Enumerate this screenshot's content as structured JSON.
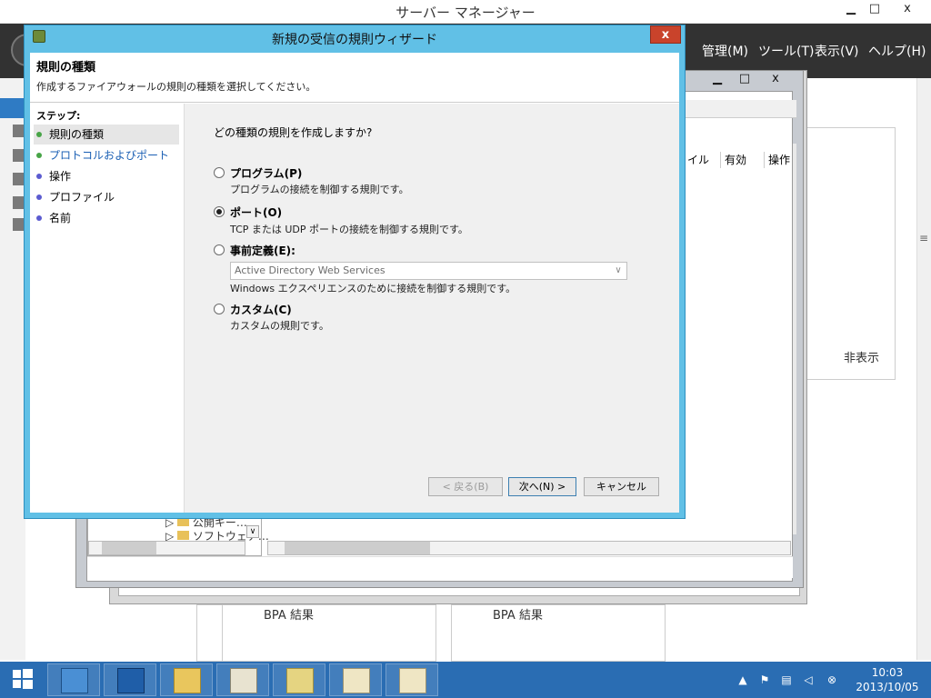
{
  "server_manager": {
    "title": "サーバー マネージャー",
    "menu": [
      "管理(M)",
      "ツール(T)",
      "表示(V)",
      "ヘルプ(H)"
    ],
    "hidden_link": "非表示",
    "bpa_label": "BPA 結果"
  },
  "background_window": {
    "columns": [
      "イル",
      "有効",
      "操作"
    ],
    "tree_items": [
      "公開キー…",
      "ソフトウェア…"
    ]
  },
  "wizard": {
    "title": "新規の受信の規則ウィザード",
    "heading": "規則の種類",
    "subtitle": "作成するファイアウォールの規則の種類を選択してください。",
    "steps_label": "ステップ:",
    "steps": [
      {
        "label": "規則の種類",
        "state": "done"
      },
      {
        "label": "プロトコルおよびポート",
        "state": "done"
      },
      {
        "label": "操作",
        "state": "pending"
      },
      {
        "label": "プロファイル",
        "state": "pending"
      },
      {
        "label": "名前",
        "state": "pending"
      }
    ],
    "question": "どの種類の規則を作成しますか?",
    "options": [
      {
        "label": "プログラム(P)",
        "description": "プログラムの接続を制御する規則です。",
        "selected": false
      },
      {
        "label": "ポート(O)",
        "description": "TCP または UDP ポートの接続を制御する規則です。",
        "selected": true
      },
      {
        "label": "事前定義(E):",
        "description": "Windows エクスペリエンスのために接続を制御する規則です。",
        "selected": false
      },
      {
        "label": "カスタム(C)",
        "description": "カスタムの規則です。",
        "selected": false
      }
    ],
    "predefined_value": "Active Directory Web Services",
    "buttons": {
      "back": "< 戻る(B)",
      "next": "次へ(N) >",
      "cancel": "キャンセル"
    },
    "close_glyph": "x"
  },
  "window_controls": {
    "minimize": "▁",
    "maximize": "□",
    "close": "x"
  },
  "taskbar": {
    "time": "10:03",
    "date": "2013/10/05"
  },
  "colors": {
    "wizard_frame": "#61c0e6",
    "taskbar": "#2a6db3",
    "close_red": "#c9432b",
    "step_done": "#47a447",
    "step_pending": "#5b5bd0"
  }
}
